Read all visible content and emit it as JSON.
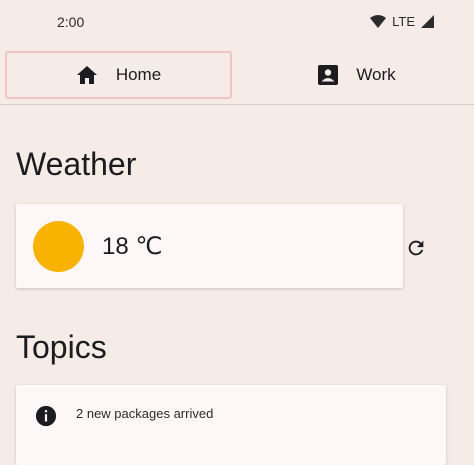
{
  "status_bar": {
    "time": "2:00",
    "network": "LTE"
  },
  "tabs": [
    {
      "label": "Home",
      "icon": "home-icon",
      "selected": true
    },
    {
      "label": "Work",
      "icon": "contact-icon",
      "selected": false
    }
  ],
  "weather": {
    "title": "Weather",
    "temperature": "18 ℃",
    "sun_color": "#f8b202"
  },
  "topics": {
    "title": "Topics",
    "items": [
      {
        "icon": "info-icon",
        "text": "2 new packages arrived"
      }
    ]
  }
}
